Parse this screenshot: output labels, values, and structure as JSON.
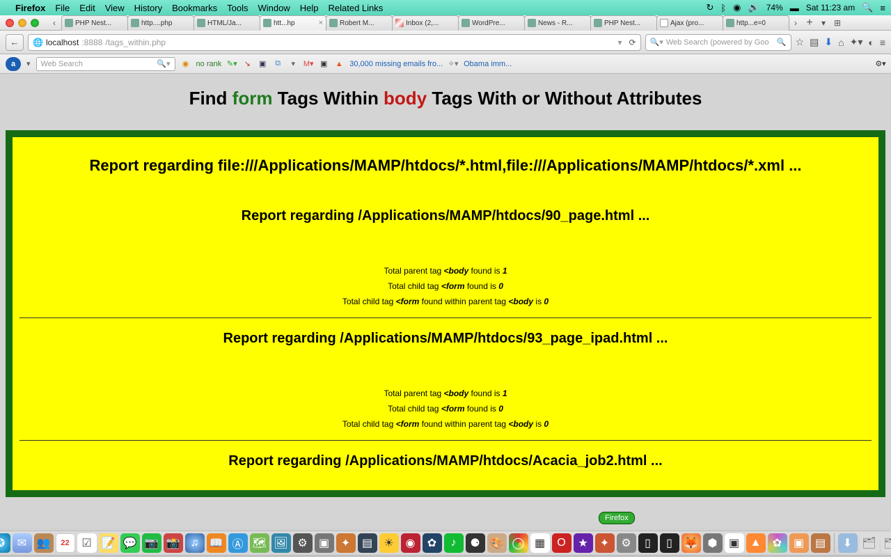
{
  "menubar": {
    "app": "Firefox",
    "items": [
      "File",
      "Edit",
      "View",
      "History",
      "Bookmarks",
      "Tools",
      "Window",
      "Help",
      "Related Links"
    ],
    "battery": "74%",
    "clock": "Sat 11:23 am"
  },
  "tabs": {
    "list": [
      {
        "label": "PHP Nest..."
      },
      {
        "label": "http....php"
      },
      {
        "label": "HTML/Ja..."
      },
      {
        "label": "htt...hp",
        "active": true
      },
      {
        "label": "Robert M..."
      },
      {
        "label": "Inbox (2,...",
        "gmail": true
      },
      {
        "label": "WordPre..."
      },
      {
        "label": "News - R..."
      },
      {
        "label": "PHP Nest..."
      },
      {
        "label": "Ajax (pro...",
        "wiki": true
      },
      {
        "label": "http...e=0"
      }
    ]
  },
  "url": {
    "host": "localhost",
    "port": ":8888",
    "path": "/tags_within.php",
    "reload": "⟳"
  },
  "search": {
    "placeholder": "Web Search (powered by Goo"
  },
  "bookbar": {
    "search_placeholder": "Web Search",
    "norank": "no rank",
    "link1": "30,000 missing emails fro...",
    "link2": "Obama imm..."
  },
  "page": {
    "title_pre": "Find ",
    "title_form": "form",
    "title_mid": " Tags Within ",
    "title_body": "body",
    "title_post": " Tags With or Without Attributes",
    "main_report": "Report regarding file:///Applications/MAMP/htdocs/*.html,file:///Applications/MAMP/htdocs/*.xml ...",
    "sections": [
      {
        "heading": "Report regarding /Applications/MAMP/htdocs/90_page.html ...",
        "parent_count": "1",
        "child_count": "0",
        "within_count": "0",
        "line1_a": "Total parent tag ",
        "line1_b": "<body",
        "line1_c": " found is ",
        "line2_a": "Total child tag ",
        "line2_b": "<form",
        "line2_c": " found is ",
        "line3_a": "Total child tag ",
        "line3_b": "<form",
        "line3_c": " found within parent tag ",
        "line3_d": "<body",
        "line3_e": " is "
      },
      {
        "heading": "Report regarding /Applications/MAMP/htdocs/93_page_ipad.html ...",
        "parent_count": "1",
        "child_count": "0",
        "within_count": "0",
        "line1_a": "Total parent tag ",
        "line1_b": "<body",
        "line1_c": " found is ",
        "line2_a": "Total child tag ",
        "line2_b": "<form",
        "line2_c": " found is ",
        "line3_a": "Total child tag ",
        "line3_b": "<form",
        "line3_c": " found within parent tag ",
        "line3_d": "<body",
        "line3_e": " is "
      },
      {
        "heading": "Report regarding /Applications/MAMP/htdocs/Acacia_job2.html ..."
      }
    ]
  },
  "tooltip": "Firefox"
}
